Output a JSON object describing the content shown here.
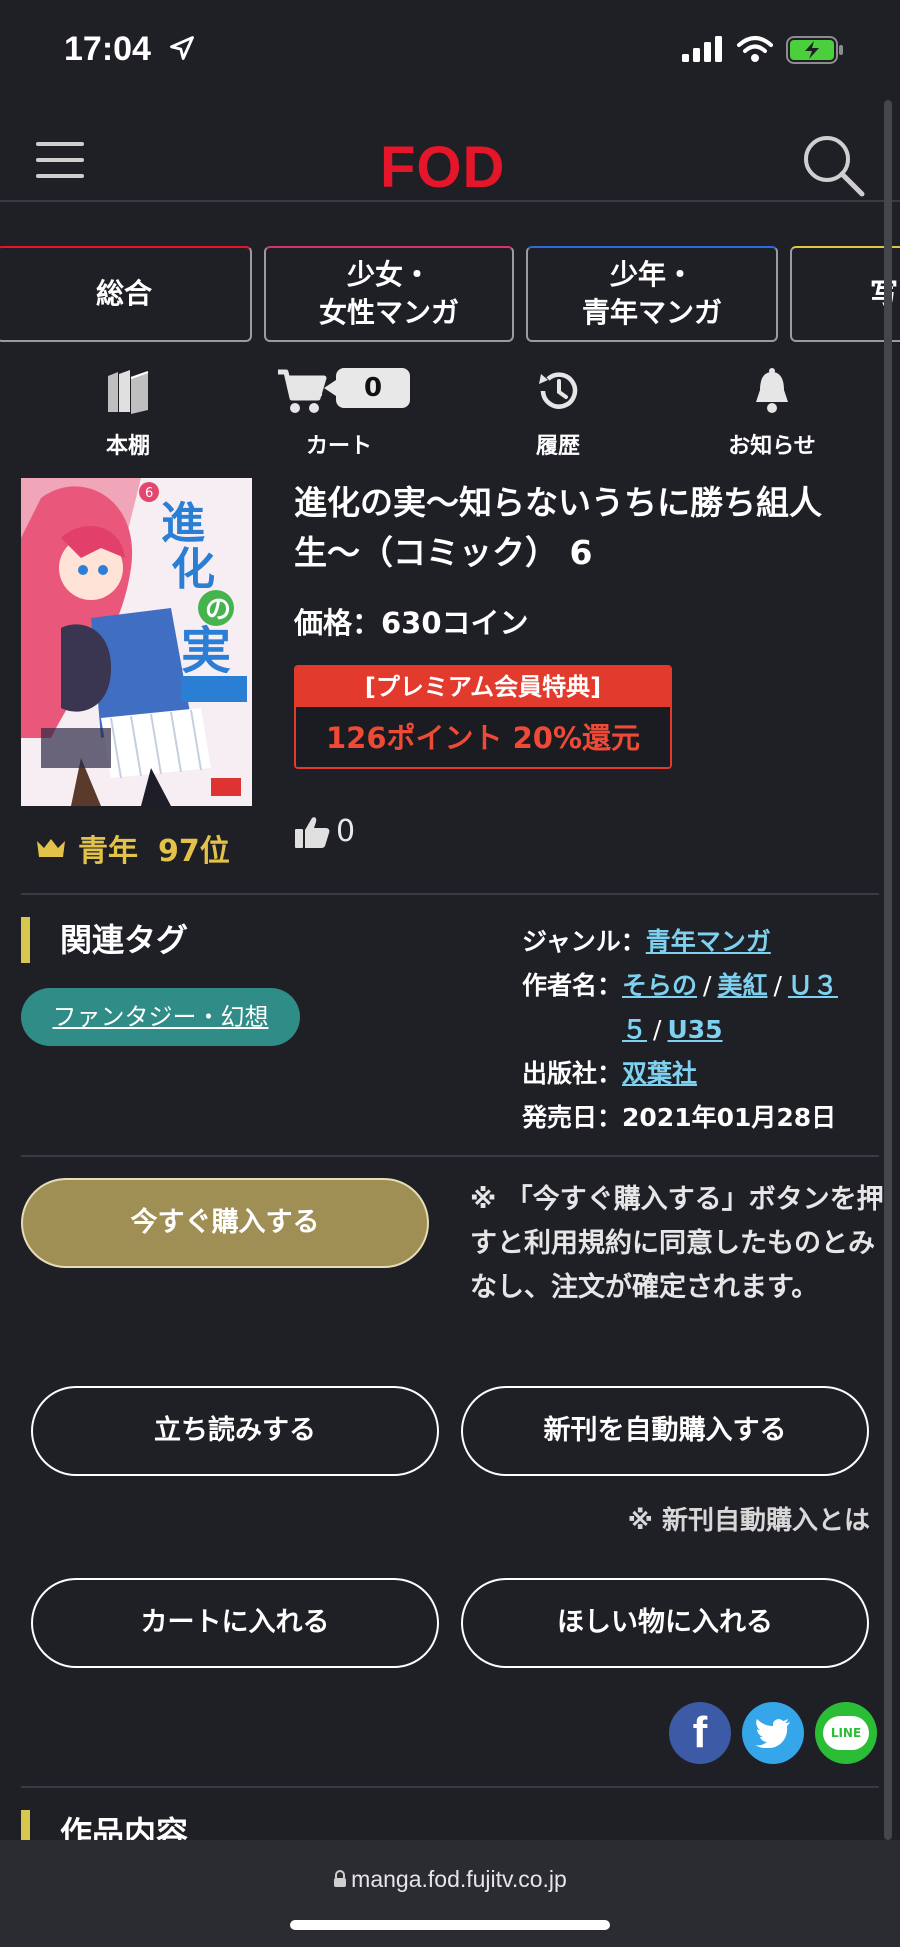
{
  "status": {
    "time": "17:04"
  },
  "header": {
    "logo": "FOD"
  },
  "categories": [
    "総合",
    "少女・\n女性マンガ",
    "少年・\n青年マンガ",
    "写"
  ],
  "quick_nav": [
    {
      "label": "本棚",
      "icon": "bookshelf-icon"
    },
    {
      "label": "カート",
      "icon": "cart-icon"
    },
    {
      "label": "履歴",
      "icon": "history-icon"
    },
    {
      "label": "お知らせ",
      "icon": "bell-icon"
    }
  ],
  "cart_count": "0",
  "book": {
    "title": "進化の実〜知らないうちに勝ち組人生〜（コミック） 6",
    "price": "価格：630コイン",
    "premium_header": "[プレミアム会員特典]",
    "premium_body": "126ポイント 20%還元",
    "likes": "0",
    "rank_genre": "青年",
    "rank_position": "97位"
  },
  "tags_section": {
    "title": "関連タグ",
    "tag": "ファンタジー・幻想"
  },
  "meta": {
    "genre_label": "ジャンル：",
    "genre": "青年マンガ",
    "author_label": "作者名：",
    "authors": [
      "そらの",
      "美紅",
      "Ｕ３５",
      "U35"
    ],
    "publisher_label": "出版社：",
    "publisher": "双葉社",
    "release_label": "発売日：",
    "release": "2021年01月28日"
  },
  "buttons": {
    "buy": "今すぐ購入する",
    "notice": "※ 「今すぐ購入する」ボタンを押すと利用規約に同意したものとみなし、注文が確定されます。",
    "preview": "立ち読みする",
    "auto_buy": "新刊を自動購入する",
    "auto_note": "※ 新刊自動購入とは",
    "cart": "カートに入れる",
    "wishlist": "ほしい物に入れる"
  },
  "social": {
    "line": "LINE"
  },
  "content_section": {
    "title": "作品内容"
  },
  "urlbar": {
    "url": "manga.fod.fujitv.co.jp"
  }
}
